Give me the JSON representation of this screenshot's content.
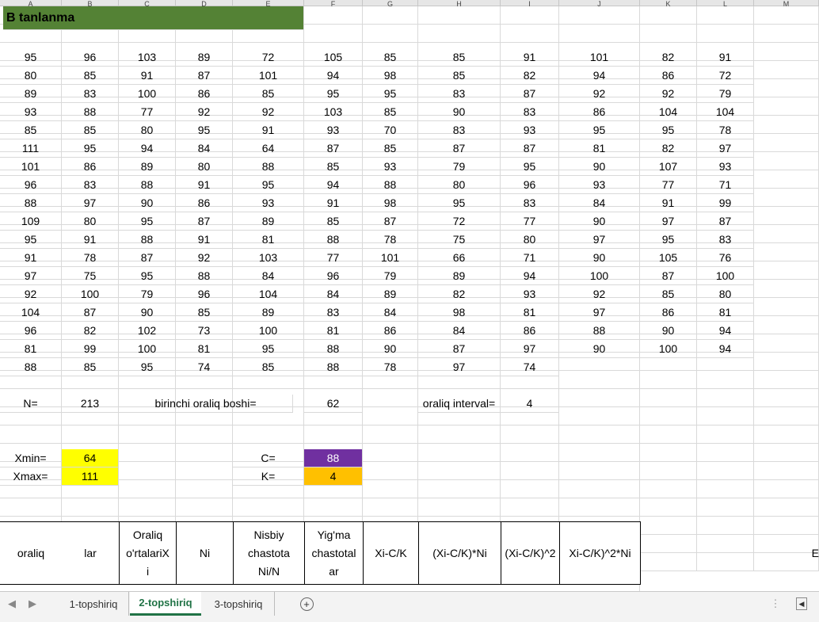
{
  "column_headers": [
    "A",
    "B",
    "C",
    "D",
    "E",
    "F",
    "G",
    "H",
    "I",
    "J",
    "K",
    "L",
    "M"
  ],
  "title": "B tanlanma",
  "data_rows": [
    [
      95,
      96,
      103,
      89,
      72,
      105,
      85,
      85,
      91,
      101,
      82,
      91
    ],
    [
      80,
      85,
      91,
      87,
      101,
      94,
      98,
      85,
      82,
      94,
      86,
      72
    ],
    [
      89,
      83,
      100,
      86,
      85,
      95,
      95,
      83,
      87,
      92,
      92,
      79
    ],
    [
      93,
      88,
      77,
      92,
      92,
      103,
      85,
      90,
      83,
      86,
      104,
      104
    ],
    [
      85,
      85,
      80,
      95,
      91,
      93,
      70,
      83,
      93,
      95,
      95,
      78
    ],
    [
      111,
      95,
      94,
      84,
      64,
      87,
      85,
      87,
      87,
      81,
      82,
      97
    ],
    [
      101,
      86,
      89,
      80,
      88,
      85,
      93,
      79,
      95,
      90,
      107,
      93
    ],
    [
      96,
      83,
      88,
      91,
      95,
      94,
      88,
      80,
      96,
      93,
      77,
      71
    ],
    [
      88,
      97,
      90,
      86,
      93,
      91,
      98,
      95,
      83,
      84,
      91,
      99
    ],
    [
      109,
      80,
      95,
      87,
      89,
      85,
      87,
      72,
      77,
      90,
      97,
      87
    ],
    [
      95,
      91,
      88,
      91,
      81,
      88,
      78,
      75,
      80,
      97,
      95,
      83
    ],
    [
      91,
      78,
      87,
      92,
      103,
      77,
      101,
      66,
      71,
      90,
      105,
      76
    ],
    [
      97,
      75,
      95,
      88,
      84,
      96,
      79,
      89,
      94,
      100,
      87,
      100
    ],
    [
      92,
      100,
      79,
      96,
      104,
      84,
      89,
      82,
      93,
      92,
      85,
      80
    ],
    [
      104,
      87,
      90,
      85,
      89,
      83,
      84,
      98,
      81,
      97,
      86,
      81
    ],
    [
      96,
      82,
      102,
      73,
      100,
      81,
      86,
      84,
      86,
      88,
      90,
      94
    ],
    [
      81,
      99,
      100,
      81,
      95,
      88,
      90,
      87,
      97,
      90,
      100,
      94
    ],
    [
      88,
      85,
      95,
      74,
      85,
      88,
      78,
      97,
      74,
      null,
      null,
      null
    ]
  ],
  "stats": {
    "n_label": "N=",
    "n_value": "213",
    "first_start_label": "birinchi oraliq boshi=",
    "first_start_value": "62",
    "interval_label": "oraliq interval=",
    "interval_value": "4",
    "xmin_label": "Xmin=",
    "xmin_value": "64",
    "xmax_label": "Xmax=",
    "xmax_value": "111",
    "c_label": "C=",
    "c_value": "88",
    "k_label": "K=",
    "k_value": "4"
  },
  "table_headers": [
    [
      "oraliq"
    ],
    [
      "lar"
    ],
    [
      "Oraliq",
      "o'rtalariX",
      "i"
    ],
    [
      "Ni"
    ],
    [
      "Nisbiy",
      "chastota",
      "Ni/N"
    ],
    [
      "Yig'ma",
      "chastotal",
      "ar"
    ],
    [
      "Xi-C/K"
    ],
    [
      "(Xi-C/K)*Ni"
    ],
    [
      "(Xi-C/K)^2"
    ],
    [
      "Xi-C/K)^2*Ni"
    ]
  ],
  "partial_m_header": "E",
  "tabs": [
    "1-topshiriq",
    "2-topshiriq",
    "3-topshiriq"
  ],
  "active_tab": "2-topshiriq",
  "add_sheet_symbol": "+",
  "colors": {
    "title_fill": "#548235",
    "yellow": "#ffff00",
    "purple": "#7030a0",
    "orange": "#ffc000",
    "active_tab_text": "#217346"
  }
}
